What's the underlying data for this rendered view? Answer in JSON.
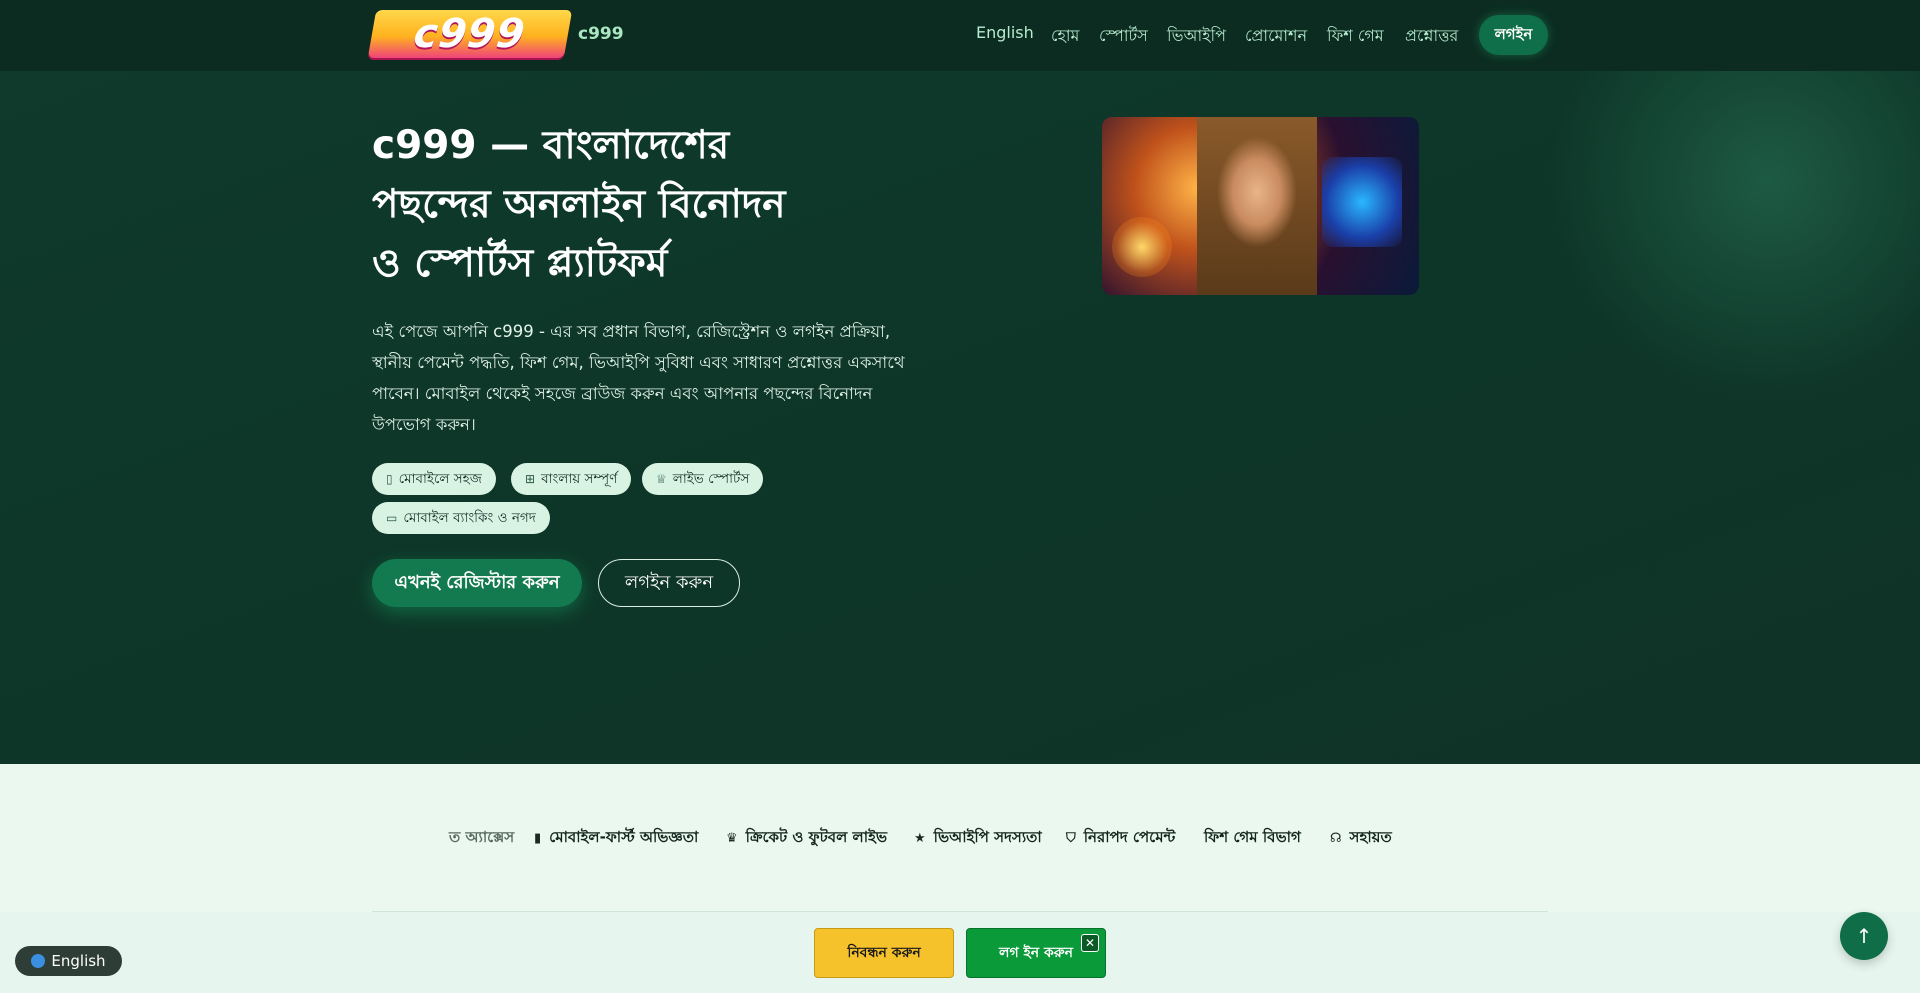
{
  "header": {
    "logo_text": "c999",
    "brand": "c999",
    "nav": [
      "English",
      "হোম",
      "স্পোর্টস",
      "ভিআইপি",
      "প্রোমোশন",
      "ফিশ গেম",
      "প্রশ্নোত্তর"
    ],
    "login": "লগইন"
  },
  "hero": {
    "title_lines": [
      "c999 — বাংলাদেশের",
      "পছন্দের অনলাইন বিনোদন",
      "ও স্পোর্টস প্ল্যাটফর্ম"
    ],
    "lead_lines": [
      "এই পেজে আপনি c999 - এর সব প্রধান বিভাগ, রেজিস্ট্রেশন ও লগইন প্রক্রিয়া,",
      "স্থানীয় পেমেন্ট পদ্ধতি, ফিশ গেম, ভিআইপি সুবিধা এবং সাধারণ প্রশ্নোত্তর একসাথে",
      "পাবেন। মোবাইল থেকেই সহজে ব্রাউজ করুন এবং আপনার পছন্দের বিনোদন",
      "উপভোগ করুন।"
    ],
    "chips": [
      {
        "icon": "phone-icon",
        "label": "মোবাইলে সহজ"
      },
      {
        "icon": "language-icon",
        "label": "বাংলায় সম্পূর্ণ"
      },
      {
        "icon": "trophy-icon",
        "label": "লাইভ স্পোর্টস"
      },
      {
        "icon": "wallet-icon",
        "label": "মোবাইল ব্যাংকিং ও নগদ"
      }
    ],
    "register_button": "এখনই রেজিস্টার করুন",
    "login_button": "লগইন করুন"
  },
  "ticker": [
    {
      "icon": "none",
      "label": "ত অ্যাক্সেস"
    },
    {
      "icon": "mobile-icon",
      "label": "মোবাইল-ফার্স্ট অভিজ্ঞতা"
    },
    {
      "icon": "trophy-icon",
      "label": "ক্রিকেট ও ফুটবল লাইভ"
    },
    {
      "icon": "star-icon",
      "label": "ভিআইপি সদস্যতা"
    },
    {
      "icon": "shield-icon",
      "label": "নিরাপদ পেমেন্ট"
    },
    {
      "icon": "fish-icon",
      "label": "ফিশ গেম বিভাগ"
    },
    {
      "icon": "headset-icon",
      "label": "সহায়ত"
    }
  ],
  "footer_bar": {
    "language": "English",
    "signup": "নিবন্ধন করুন",
    "login": "লগ ইন করুন",
    "close": "✕",
    "to_top": "↑"
  }
}
